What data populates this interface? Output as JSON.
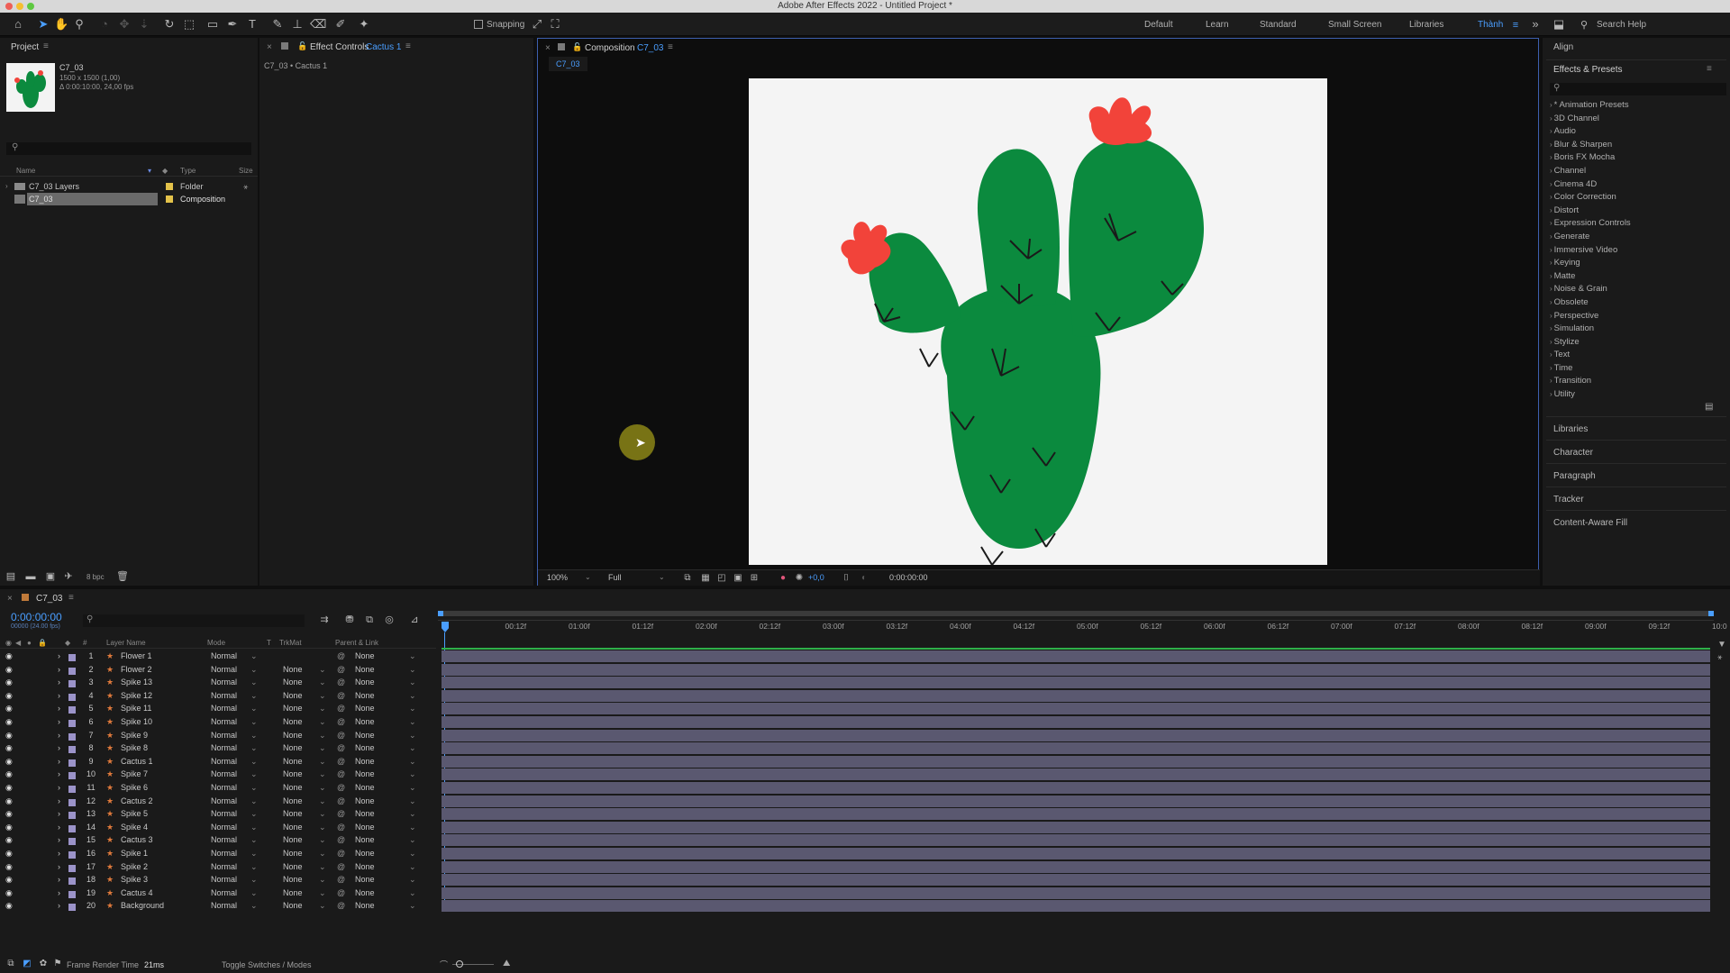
{
  "window": {
    "title": "Adobe After Effects 2022 - Untitled Project *"
  },
  "toolbar": {
    "snapping_label": "Snapping",
    "workspaces": [
      "Default",
      "Learn",
      "Standard",
      "Small Screen",
      "Libraries",
      "Thành"
    ],
    "active_workspace": "Thành",
    "search_help": "Search Help"
  },
  "project": {
    "tab": "Project",
    "item_name": "C7_03",
    "item_info_1": "1500 x 1500 (1,00)",
    "item_info_2": "Δ 0:00:10:00, 24,00 fps",
    "columns": {
      "name": "Name",
      "type": "Type",
      "size": "Size"
    },
    "items": [
      {
        "name": "C7_03 Layers",
        "type": "Folder"
      },
      {
        "name": "C7_03",
        "type": "Composition"
      }
    ],
    "bpc": "8 bpc"
  },
  "effect_controls": {
    "tab_prefix": "Effect Controls",
    "tab_layer": "Cactus 1",
    "breadcrumb": "C7_03 • Cactus 1"
  },
  "composition": {
    "tab_prefix": "Composition",
    "tab_name": "C7_03",
    "sub_tab": "C7_03",
    "zoom": "100%",
    "resolution": "Full",
    "exposure": "+0,0",
    "timecode": "0:00:00:00"
  },
  "right_panel": {
    "align": "Align",
    "effects_title": "Effects & Presets",
    "effects": [
      "* Animation Presets",
      "3D Channel",
      "Audio",
      "Blur & Sharpen",
      "Boris FX Mocha",
      "Channel",
      "Cinema 4D",
      "Color Correction",
      "Distort",
      "Expression Controls",
      "Generate",
      "Immersive Video",
      "Keying",
      "Matte",
      "Noise & Grain",
      "Obsolete",
      "Perspective",
      "Simulation",
      "Stylize",
      "Text",
      "Time",
      "Transition",
      "Utility"
    ],
    "panels": [
      "Libraries",
      "Character",
      "Paragraph",
      "Tracker",
      "Content-Aware Fill"
    ]
  },
  "timeline": {
    "tab": "C7_03",
    "timecode": "0:00:00:00",
    "frame_info": "00000 (24.00 fps)",
    "columns": {
      "num": "#",
      "layer_name": "Layer Name",
      "mode": "Mode",
      "t": "T",
      "trkmat": "TrkMat",
      "parent": "Parent & Link"
    },
    "ruler": [
      "0f",
      "00:12f",
      "01:00f",
      "01:12f",
      "02:00f",
      "02:12f",
      "03:00f",
      "03:12f",
      "04:00f",
      "04:12f",
      "05:00f",
      "05:12f",
      "06:00f",
      "06:12f",
      "07:00f",
      "07:12f",
      "08:00f",
      "08:12f",
      "09:00f",
      "09:12f",
      "10:0"
    ],
    "layers": [
      {
        "num": "1",
        "name": "Flower 1",
        "mode": "Normal",
        "trkmat": "",
        "parent": "None"
      },
      {
        "num": "2",
        "name": "Flower 2",
        "mode": "Normal",
        "trkmat": "None",
        "parent": "None"
      },
      {
        "num": "3",
        "name": "Spike 13",
        "mode": "Normal",
        "trkmat": "None",
        "parent": "None"
      },
      {
        "num": "4",
        "name": "Spike 12",
        "mode": "Normal",
        "trkmat": "None",
        "parent": "None"
      },
      {
        "num": "5",
        "name": "Spike 11",
        "mode": "Normal",
        "trkmat": "None",
        "parent": "None"
      },
      {
        "num": "6",
        "name": "Spike 10",
        "mode": "Normal",
        "trkmat": "None",
        "parent": "None"
      },
      {
        "num": "7",
        "name": "Spike 9",
        "mode": "Normal",
        "trkmat": "None",
        "parent": "None"
      },
      {
        "num": "8",
        "name": "Spike 8",
        "mode": "Normal",
        "trkmat": "None",
        "parent": "None"
      },
      {
        "num": "9",
        "name": "Cactus 1",
        "mode": "Normal",
        "trkmat": "None",
        "parent": "None"
      },
      {
        "num": "10",
        "name": "Spike 7",
        "mode": "Normal",
        "trkmat": "None",
        "parent": "None"
      },
      {
        "num": "11",
        "name": "Spike 6",
        "mode": "Normal",
        "trkmat": "None",
        "parent": "None"
      },
      {
        "num": "12",
        "name": "Cactus 2",
        "mode": "Normal",
        "trkmat": "None",
        "parent": "None"
      },
      {
        "num": "13",
        "name": "Spike 5",
        "mode": "Normal",
        "trkmat": "None",
        "parent": "None"
      },
      {
        "num": "14",
        "name": "Spike 4",
        "mode": "Normal",
        "trkmat": "None",
        "parent": "None"
      },
      {
        "num": "15",
        "name": "Cactus 3",
        "mode": "Normal",
        "trkmat": "None",
        "parent": "None"
      },
      {
        "num": "16",
        "name": "Spike 1",
        "mode": "Normal",
        "trkmat": "None",
        "parent": "None"
      },
      {
        "num": "17",
        "name": "Spike 2",
        "mode": "Normal",
        "trkmat": "None",
        "parent": "None"
      },
      {
        "num": "18",
        "name": "Spike 3",
        "mode": "Normal",
        "trkmat": "None",
        "parent": "None"
      },
      {
        "num": "19",
        "name": "Cactus 4",
        "mode": "Normal",
        "trkmat": "None",
        "parent": "None"
      },
      {
        "num": "20",
        "name": "Background",
        "mode": "Normal",
        "trkmat": "None",
        "parent": "None"
      }
    ],
    "frame_render_label": "Frame Render Time",
    "frame_render_value": "21ms",
    "toggle_label": "Toggle Switches / Modes"
  },
  "colors": {
    "accent": "#2d8ceb",
    "cactus_green": "#0b8a3e",
    "flower_red": "#f2433a",
    "layer_label": "#9b93c9",
    "bar": "#5a5870"
  }
}
